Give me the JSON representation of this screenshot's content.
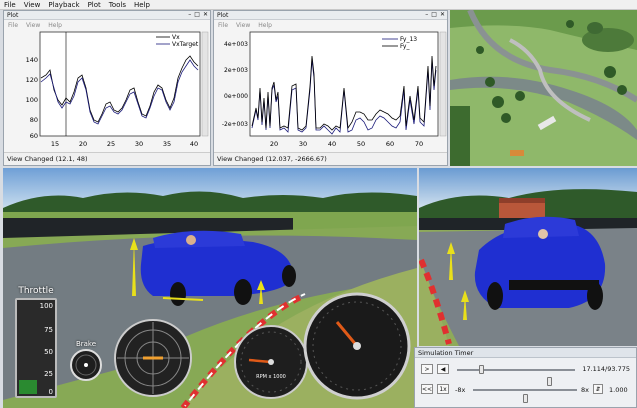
{
  "menu": [
    "File",
    "View",
    "Playback",
    "Plot",
    "Tools",
    "Help"
  ],
  "plot1": {
    "window_title": "Plot",
    "menu": [
      "File",
      "View",
      "Help"
    ],
    "legend": [
      "Vx",
      "VxTarget"
    ],
    "y_ticks": [
      "140",
      "120",
      "100",
      "80",
      "60"
    ],
    "x_ticks": [
      "15",
      "20",
      "25",
      "30",
      "35",
      "40"
    ],
    "status": "View Changed (12.1, 48)"
  },
  "plot2": {
    "window_title": "Plot",
    "menu": [
      "File",
      "View",
      "Help"
    ],
    "legend": [
      "Fy_13",
      "Fy_"
    ],
    "y_ticks": [
      "4e+003",
      "2e+003",
      "0e+000",
      "-2e+003"
    ],
    "x_ticks": [
      "20",
      "30",
      "40",
      "50",
      "60",
      "70"
    ],
    "status": "View Changed (12.037, -2666.67)"
  },
  "dash": {
    "throttle_label": "Throttle",
    "throttle_ticks": [
      "100",
      "75",
      "50",
      "25",
      "0"
    ],
    "brake_label": "Brake",
    "rpm_label": "RPM x 1000"
  },
  "timer": {
    "title": "Simulation Timer",
    "time_readout": "17.114/93.775",
    "speed_min": "-8x",
    "speed_max": "8x",
    "speed_value": "1.000",
    "play_label": ">",
    "rewind_label": "<<",
    "onex_label": "1x"
  }
}
